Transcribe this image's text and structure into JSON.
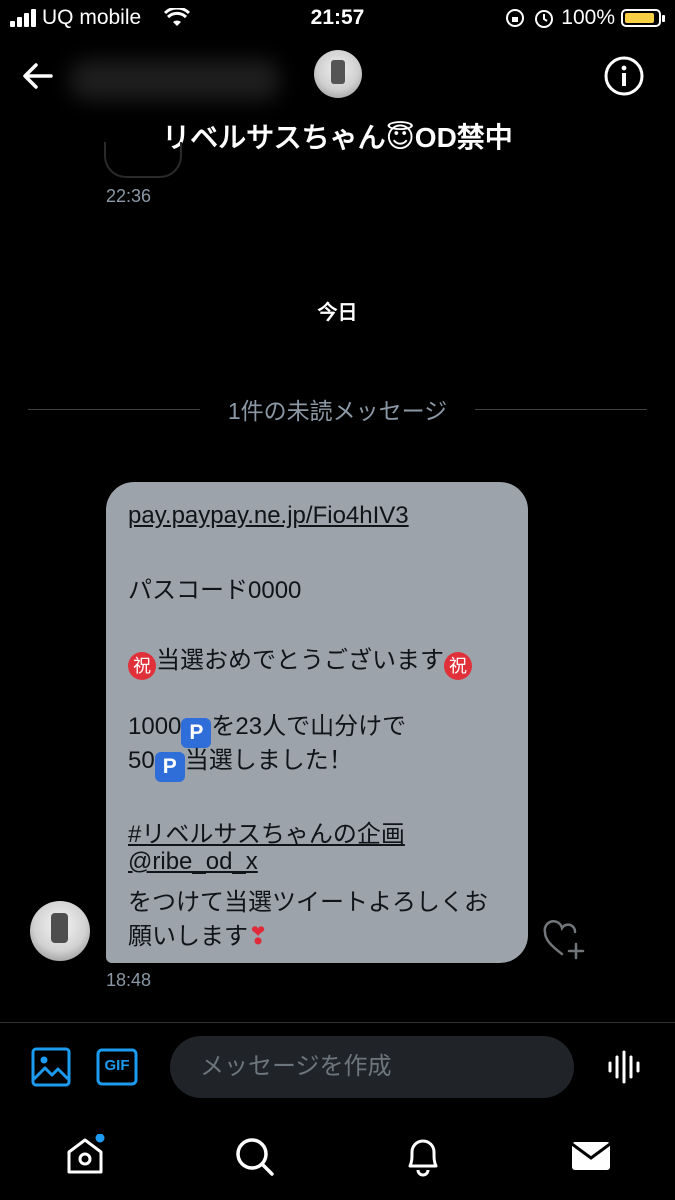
{
  "status_bar": {
    "carrier": "UQ mobile",
    "time": "21:57",
    "battery": "100%"
  },
  "header": {
    "title": "リベルサスちゃん😇OD禁中"
  },
  "thread": {
    "previous_time": "22:36",
    "day_label": "今日",
    "unread_label": "1件の未読メッセージ"
  },
  "message": {
    "link": "pay.paypay.ne.jp/Fio4hIV3",
    "passcode": "パスコード0000",
    "congrats_emoji": "祝",
    "congrats_text": "当選おめでとうございます",
    "line4_a": "1000",
    "line4_b": "を23人で山分けで",
    "line5_a": "50",
    "line5_b": "当選しました！",
    "point_emoji": "P",
    "hashtag": "#リベルサスちゃんの企画",
    "mention": "@ribe_od_x",
    "line8": "をつけて当選ツイートよろしくお",
    "line9": "願いします",
    "heart_emoji": "❣",
    "time": "18:48"
  },
  "composer": {
    "placeholder": "メッセージを作成",
    "gif_label": "GIF"
  },
  "icons": [
    "back-arrow-icon",
    "info-icon",
    "heart-plus-icon",
    "image-icon",
    "gif-icon",
    "voice-icon",
    "home-icon",
    "search-icon",
    "bell-icon",
    "mail-icon"
  ],
  "colors": {
    "accent": "#1d9bf0",
    "bubble": "#9ca3ab",
    "battery": "#f7cf45",
    "muted": "#8b98a5"
  }
}
